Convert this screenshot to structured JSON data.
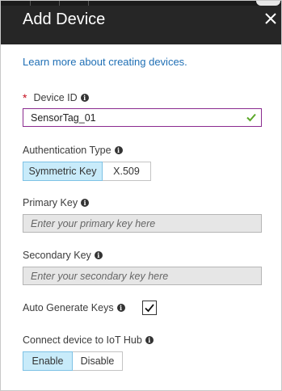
{
  "header": {
    "title": "Add Device",
    "close_icon": "close-icon"
  },
  "learn_more_link": "Learn more about creating devices.",
  "device_id": {
    "required_marker": "*",
    "label": "Device ID",
    "value": "SensorTag_01",
    "valid_icon": "checkmark-icon"
  },
  "authentication_type": {
    "label": "Authentication Type",
    "options": [
      "Symmetric Key",
      "X.509"
    ],
    "selected": "Symmetric Key"
  },
  "primary_key": {
    "label": "Primary Key",
    "placeholder": "Enter your primary key here"
  },
  "secondary_key": {
    "label": "Secondary Key",
    "placeholder": "Enter your secondary key here"
  },
  "auto_generate_keys": {
    "label": "Auto Generate Keys",
    "checked": true
  },
  "connect_to_hub": {
    "label": "Connect device to IoT Hub",
    "options": [
      "Enable",
      "Disable"
    ],
    "selected": "Enable"
  },
  "colors": {
    "header_bg": "#262626",
    "link": "#1f6fb5",
    "valid_border": "#8a2b8f",
    "valid_check": "#5ba829",
    "selected_toggle": "#c8ebfa",
    "required": "#c50f1f"
  }
}
